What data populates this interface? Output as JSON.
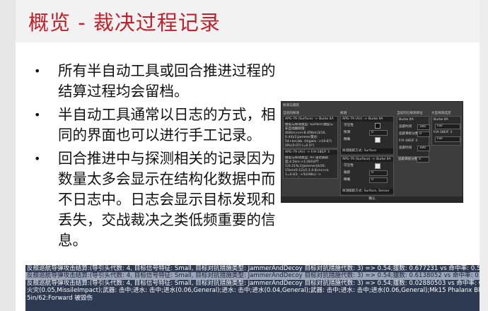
{
  "slide": {
    "title": "概览 - 裁决过程记录",
    "bullet_marker": "•",
    "bullets": [
      "所有半自动工具或回合推进过程的结算过程均会留档。",
      "半自动工具通常以日志的方式，相同的界面也可以进行手工记录。",
      "回合推进中与探测相关的记录因为数量太多会显示在结构化数据中而不日志中。日志会显示目标发现和丢失，交战裁决之类低频重要的信息。"
    ]
  },
  "screenshot": {
    "header": "探测与捕获",
    "col1_title": "当前的探测",
    "col2_title": "探测",
    "col3_title": "当前的已探测单位",
    "col4_title": "大型探测选定",
    "block1_header": "APG-79 (Surface) -> Burke IIA",
    "block1_text": "捷度与探测类型: Surface;捷度与非自动跟踪值: 40/km;rcs<8.45Km(3/10, 0.44)/2;Jammer雷达: 54+km;bb. (Higwlv ->16-87) [IRL(0.07) I=0.5?] MediumSmall;1",
    "block2_header": "APG-79 (Air) -> F/A-18E/F 3",
    "block2_text": "捷度与探测类型: Air 雷达跟踪度;4.5km->1;(6X)(PT 1)0.21%;1(Jammer)/LOS: 15km(0-12)/1;1.0.8;rcs>ra 1=0.83; ->5(HiWv) -> HighAir;1",
    "mid_header1": "APG-79 (Air) -> Burke IIA",
    "mid_rows1": [
      {
        "label": "可见性",
        "value": ""
      },
      {
        "label": "探测",
        "value": "0"
      },
      {
        "label": "精确",
        "value": ""
      }
    ],
    "mid_band1": "探测跟踪方式: Surface",
    "mid_header2": "APG-79 (Surface) -> Burke IIA",
    "mid_rows2": [
      {
        "label": "可见性",
        "value": ""
      },
      {
        "label": "跟踪",
        "value": "0"
      },
      {
        "label": "精确",
        "value": "0"
      }
    ],
    "mid_band2": "探测跟踪方式: Surface, Sensor",
    "col3_item1": "Burke IIA",
    "col3_rows1": [
      {
        "label": "追踪时间",
        "value": "180"
      },
      {
        "label": "追踪目标分数",
        "value": "0"
      }
    ],
    "col3_item2": "F/A-18E/F 3",
    "col3_rows2": [
      {
        "label": "追踪时间",
        "value": "180"
      },
      {
        "label": "追踪目标分数",
        "value": "0"
      }
    ],
    "col4_item1": "Burke IIA",
    "col4_sel1": "Fair",
    "col4_item2": "F/A-18E/F 3",
    "col4_sel2": "Fair",
    "footer_button": "确认"
  },
  "log_lines": [
    {
      "text": "反舰巡航导弹攻击结算:(导引头代数: 4, 目标信号特征: Small, 目标对抗措施类型: JammerAndDecoy 目标对抗措施代数: 3) => 0.54;摆数: 0.677231 vs 命中率: 0.54;未命中;",
      "highlight": false
    },
    {
      "text": "反舰巡航导弹攻击结算:(导引头代数: 4, 目标信号特征: Small, 目标对抗措施类型: JammerAndDecoy 目标对抗措施代数: 3) => 0.54;摆数: 0.6138052 vs 命中率: 0.54;未命中;",
      "highlight": true
    },
    {
      "text": "反舰巡航导弹攻击结算:(导引头代数: 4, 目标信号特征: Small, 目标对抗措施类型: JammerAndDecoy 目标对抗措施代数: 3) => 0.54;摆数: 0.02880503 vs 命中率: 0.54;穿甲 15 vs 装甲 0: 46 - 46;最终毁伤点: 46(((毁伤点=46, 剩余毁伤点=249 -> 损伤率=0.1847389), D6=6) => 毁伤: 2;武器致命损伤=D3(+0) => 武器致命损伤=3;毁伤点=46 >= 10 => +1 火灾 (高温发动机与燃油",
      "highlight": false
    },
    {
      "text": "火灾(0.05,MissileImpact);武器: 击中;进水: 击中;进水(0.06,General);进水: 击中;进水(0.04,General);武器: 击中;进水: 击中;进水(0.06,General);Mk15 Phalanx Blk IA:After 被毁伤;Mk45 Mod 4",
      "highlight": false
    },
    {
      "text": "5in/62:Forward 被毁伤",
      "highlight": false
    }
  ]
}
